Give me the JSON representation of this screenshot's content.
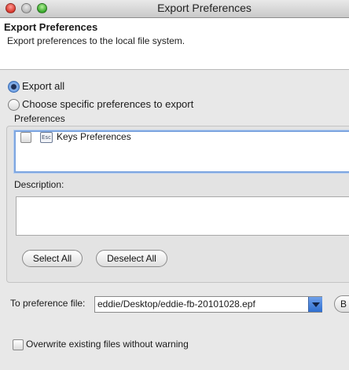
{
  "window": {
    "title": "Export Preferences"
  },
  "header": {
    "title": "Export Preferences",
    "description": "Export preferences to the local file system."
  },
  "options": {
    "export_all": "Export all",
    "choose_specific": "Choose specific preferences to export",
    "selected": "export_all"
  },
  "preferences": {
    "label": "Preferences",
    "items": [
      {
        "label": "Keys Preferences",
        "icon": "keys-preferences-icon",
        "checked": false
      }
    ]
  },
  "description": {
    "label": "Description:",
    "value": ""
  },
  "buttons": {
    "select_all": "Select All",
    "deselect_all": "Deselect All",
    "browse_partial": "B"
  },
  "destination": {
    "label": "To preference file:",
    "value": "eddie/Desktop/eddie-fb-20101028.epf"
  },
  "overwrite": {
    "label": "Overwrite existing files without warning",
    "checked": false
  },
  "colors": {
    "focus_ring": "#7ea6e0",
    "combo_arrow": "#2f6fd0"
  }
}
